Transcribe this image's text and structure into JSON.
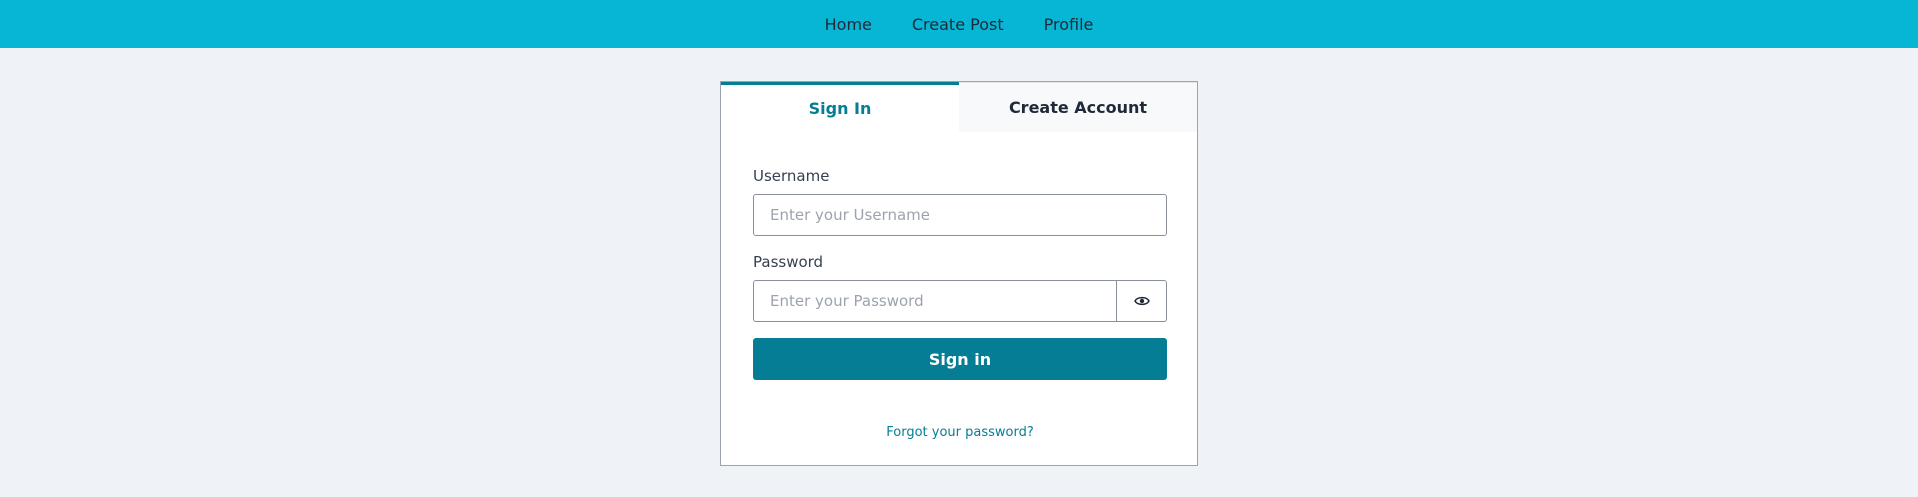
{
  "nav": {
    "items": [
      {
        "label": "Home"
      },
      {
        "label": "Create Post"
      },
      {
        "label": "Profile"
      }
    ]
  },
  "auth": {
    "tabs": [
      {
        "label": "Sign In",
        "active": true
      },
      {
        "label": "Create Account",
        "active": false
      }
    ],
    "username_label": "Username",
    "username_placeholder": "Enter your Username",
    "password_label": "Password",
    "password_placeholder": "Enter your Password",
    "show_password_icon": "eye-icon",
    "signin_label": "Sign in",
    "forgot_label": "Forgot your password?"
  },
  "colors": {
    "nav_bg": "#06b6d4",
    "accent": "#047d95",
    "page_bg": "#eff3f8"
  }
}
